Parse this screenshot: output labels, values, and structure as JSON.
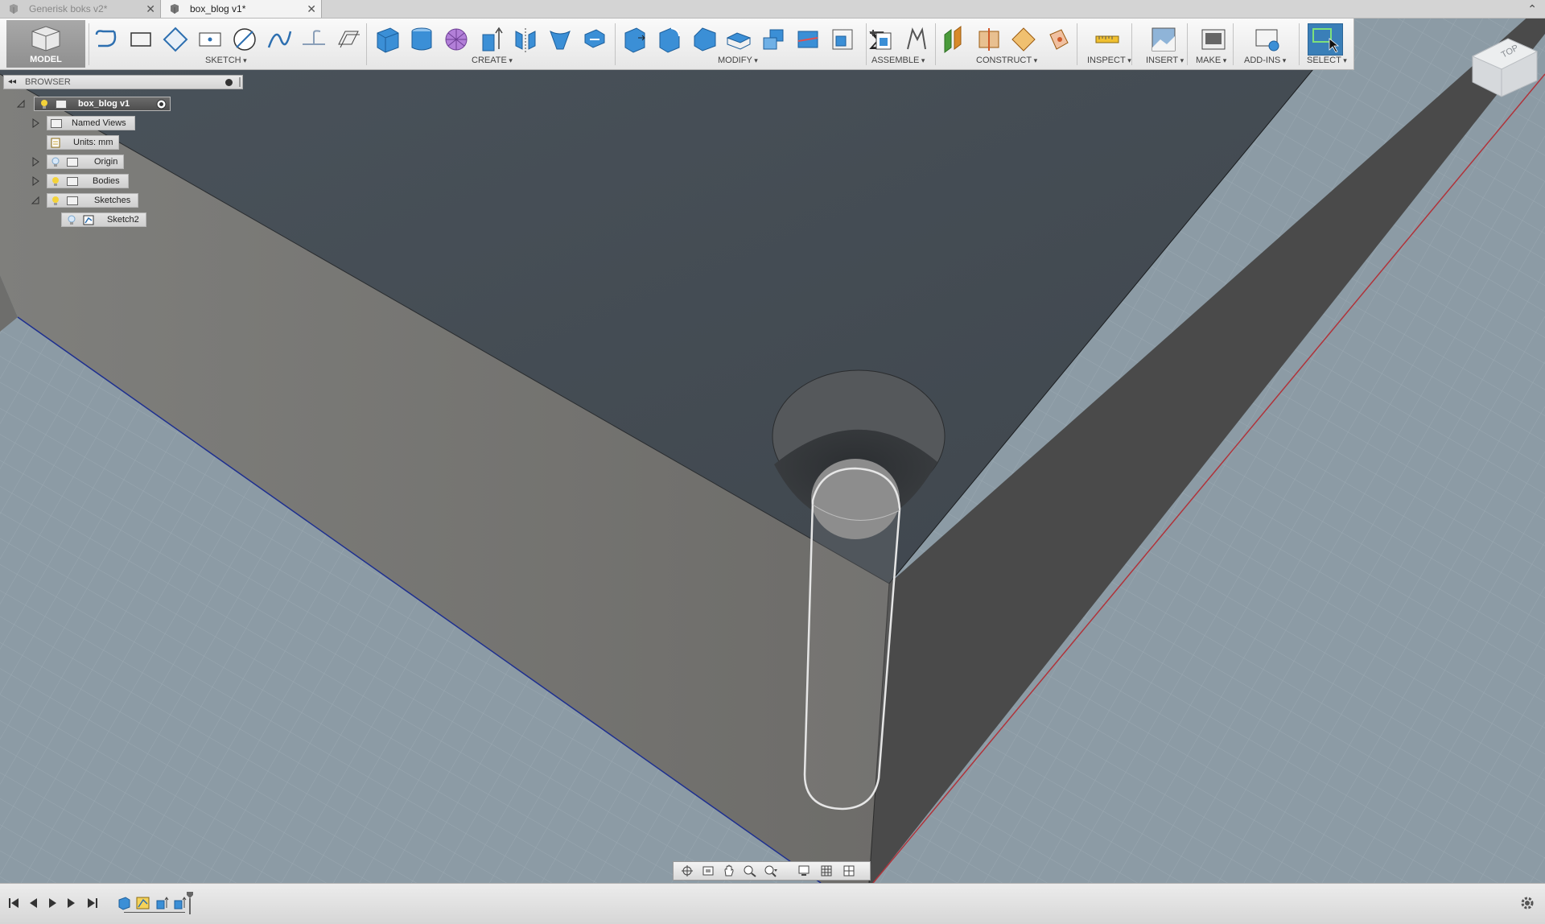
{
  "tabs": [
    {
      "label": "Generisk boks v2*",
      "active": false
    },
    {
      "label": "box_blog v1*",
      "active": true
    }
  ],
  "toolbar": {
    "model_label": "MODEL",
    "groups": {
      "sketch": "SKETCH",
      "create": "CREATE",
      "modify": "MODIFY",
      "assemble": "ASSEMBLE",
      "construct": "CONSTRUCT",
      "inspect": "INSPECT",
      "insert": "INSERT",
      "make": "MAKE",
      "addins": "ADD-INS",
      "select": "SELECT"
    }
  },
  "browser": {
    "title": "BROWSER",
    "root": "box_blog v1",
    "items": [
      {
        "label": "Named Views"
      },
      {
        "label": "Units: mm"
      },
      {
        "label": "Origin"
      },
      {
        "label": "Bodies"
      },
      {
        "label": "Sketches"
      },
      {
        "label": "Sketch2"
      }
    ]
  },
  "viewcube": {
    "face_label": "TOP"
  },
  "colors": {
    "accent": "#3a7fb8",
    "grid_bg": "#8a9aa4",
    "body_top": "#454d55",
    "body_front": "#7b7b78",
    "body_right": "#4a4a4a",
    "edge_red": "#b0333a",
    "edge_blue": "#1e2f8f"
  }
}
